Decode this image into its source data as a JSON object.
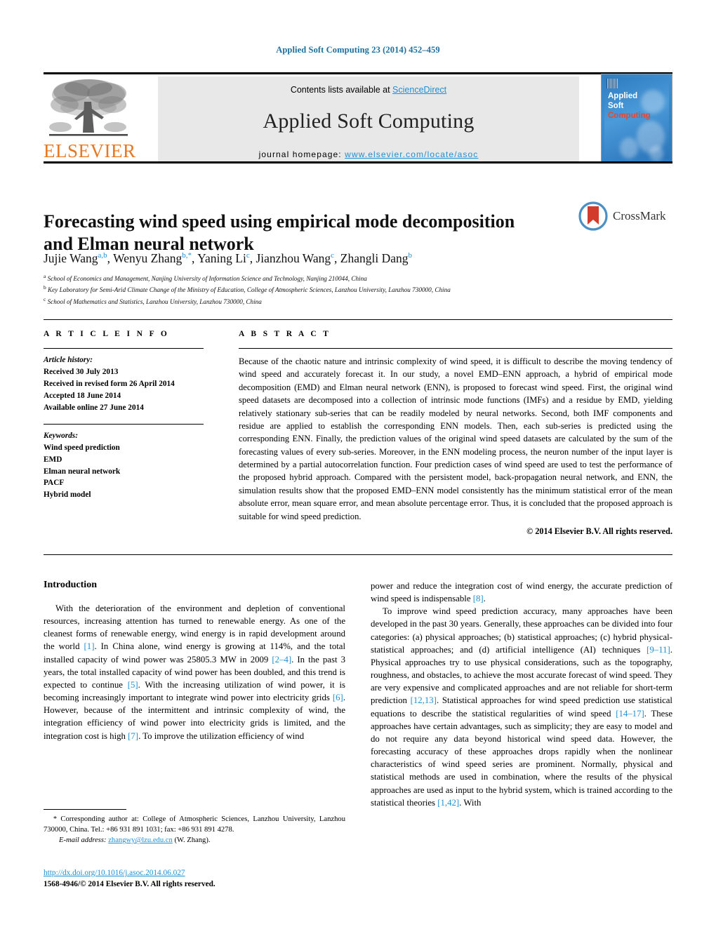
{
  "running_head": "Applied Soft Computing 23 (2014) 452–459",
  "masthead": {
    "publisher_logo_text": "ELSEVIER",
    "contents_prefix": "Contents lists available at ",
    "contents_link": "ScienceDirect",
    "journal_name": "Applied Soft Computing",
    "homepage_prefix": "journal homepage: ",
    "homepage_url": "www.elsevier.com/locate/asoc",
    "cover": {
      "line1": "Applied",
      "line2": "Soft",
      "line3": "Computing"
    }
  },
  "article": {
    "title": "Forecasting wind speed using empirical mode decomposition and Elman neural network",
    "crossmark_label": "CrossMark",
    "authors_html": "Jujie Wang<sup>a,b</sup>, Wenyu Zhang<sup>b,<span class=\"star\">*</span></sup>, Yaning Li<sup>c</sup>, Jianzhou Wang<sup>c</sup>, Zhangli Dang<sup>b</sup>",
    "affiliations": [
      {
        "mark": "a",
        "text": "School of Economics and Management, Nanjing University of Information Science and Technology, Nanjing 210044, China"
      },
      {
        "mark": "b",
        "text": "Key Laboratory for Semi-Arid Climate Change of the Ministry of Education, College of Atmospheric Sciences, Lanzhou University, Lanzhou 730000, China"
      },
      {
        "mark": "c",
        "text": "School of Mathematics and Statistics, Lanzhou University, Lanzhou 730000, China"
      }
    ]
  },
  "article_info": {
    "heading": "A R T I C L E    I N F O",
    "history_label": "Article history:",
    "history": [
      "Received 30 July 2013",
      "Received in revised form 26 April 2014",
      "Accepted 18 June 2014",
      "Available online 27 June 2014"
    ],
    "keywords_label": "Keywords:",
    "keywords": [
      "Wind speed prediction",
      "EMD",
      "Elman neural network",
      "PACF",
      "Hybrid model"
    ]
  },
  "abstract": {
    "heading": "A B S T R A C T",
    "text": "Because of the chaotic nature and intrinsic complexity of wind speed, it is difficult to describe the moving tendency of wind speed and accurately forecast it. In our study, a novel EMD–ENN approach, a hybrid of empirical mode decomposition (EMD) and Elman neural network (ENN), is proposed to forecast wind speed. First, the original wind speed datasets are decomposed into a collection of intrinsic mode functions (IMFs) and a residue by EMD, yielding relatively stationary sub-series that can be readily modeled by neural networks. Second, both IMF components and residue are applied to establish the corresponding ENN models. Then, each sub-series is predicted using the corresponding ENN. Finally, the prediction values of the original wind speed datasets are calculated by the sum of the forecasting values of every sub-series. Moreover, in the ENN modeling process, the neuron number of the input layer is determined by a partial autocorrelation function. Four prediction cases of wind speed are used to test the performance of the proposed hybrid approach. Compared with the persistent model, back-propagation neural network, and ENN, the simulation results show that the proposed EMD–ENN model consistently has the minimum statistical error of the mean absolute error, mean square error, and mean absolute percentage error. Thus, it is concluded that the proposed approach is suitable for wind speed prediction.",
    "copyright": "© 2014 Elsevier B.V. All rights reserved."
  },
  "body": {
    "section_title": "Introduction",
    "left_paragraphs_html": [
      "With the deterioration of the environment and depletion of conventional resources, increasing attention has turned to renewable energy. As one of the cleanest forms of renewable energy, wind energy is in rapid development around the world <span class=\"ref\">[1]</span>. In China alone, wind energy is growing at 114%, and the total installed capacity of wind power was 25805.3 MW in 2009 <span class=\"ref\">[2–4]</span>. In the past 3 years, the total installed capacity of wind power has been doubled, and this trend is expected to continue <span class=\"ref\">[5]</span>. With the increasing utilization of wind power, it is becoming increasingly important to integrate wind power into electricity grids <span class=\"ref\">[6]</span>. However, because of the intermittent and intrinsic complexity of wind, the integration efficiency of wind power into electricity grids is limited, and the integration cost is high <span class=\"ref\">[7]</span>. To improve the utilization efficiency of wind"
    ],
    "right_paragraphs_html": [
      "power and reduce the integration cost of wind energy, the accurate prediction of wind speed is indispensable <span class=\"ref\">[8]</span>.",
      "To improve wind speed prediction accuracy, many approaches have been developed in the past 30 years. Generally, these approaches can be divided into four categories: (a) physical approaches; (b) statistical approaches; (c) hybrid physical-statistical approaches; and (d) artificial intelligence (AI) techniques <span class=\"ref\">[9–11]</span>. Physical approaches try to use physical considerations, such as the topography, roughness, and obstacles, to achieve the most accurate forecast of wind speed. They are very expensive and complicated approaches and are not reliable for short-term prediction <span class=\"ref\">[12,13]</span>. Statistical approaches for wind speed prediction use statistical equations to describe the statistical regularities of wind speed <span class=\"ref\">[14–17]</span>. These approaches have certain advantages, such as simplicity; they are easy to model and do not require any data beyond historical wind speed data. However, the forecasting accuracy of these approaches drops rapidly when the nonlinear characteristics of wind speed series are prominent. Normally, physical and statistical methods are used in combination, where the results of the physical approaches are used as input to the hybrid system, which is trained according to the statistical theories <span class=\"ref\">[1,42]</span>. With"
    ]
  },
  "footnotes": {
    "corresponding_html": "<span class=\"star\">*</span> Corresponding author at: College of Atmospheric Sciences, Lanzhou University, Lanzhou 730000, China. Tel.: +86 931 891 1031; fax: +86 931 891 4278.",
    "email_label": "E-mail address:",
    "email": "zhangwy@lzu.edu.cn",
    "email_suffix": "(W. Zhang).",
    "doi_url": "http://dx.doi.org/10.1016/j.asoc.2014.06.027",
    "issn_line": "1568-4946/© 2014 Elsevier B.V. All rights reserved."
  },
  "colors": {
    "link": "#1f8fd0",
    "running_head": "#1f6f9c",
    "elsevier_orange": "#E87722",
    "cover_blue": "#3d8fd4",
    "cover_red": "#e8472c"
  }
}
